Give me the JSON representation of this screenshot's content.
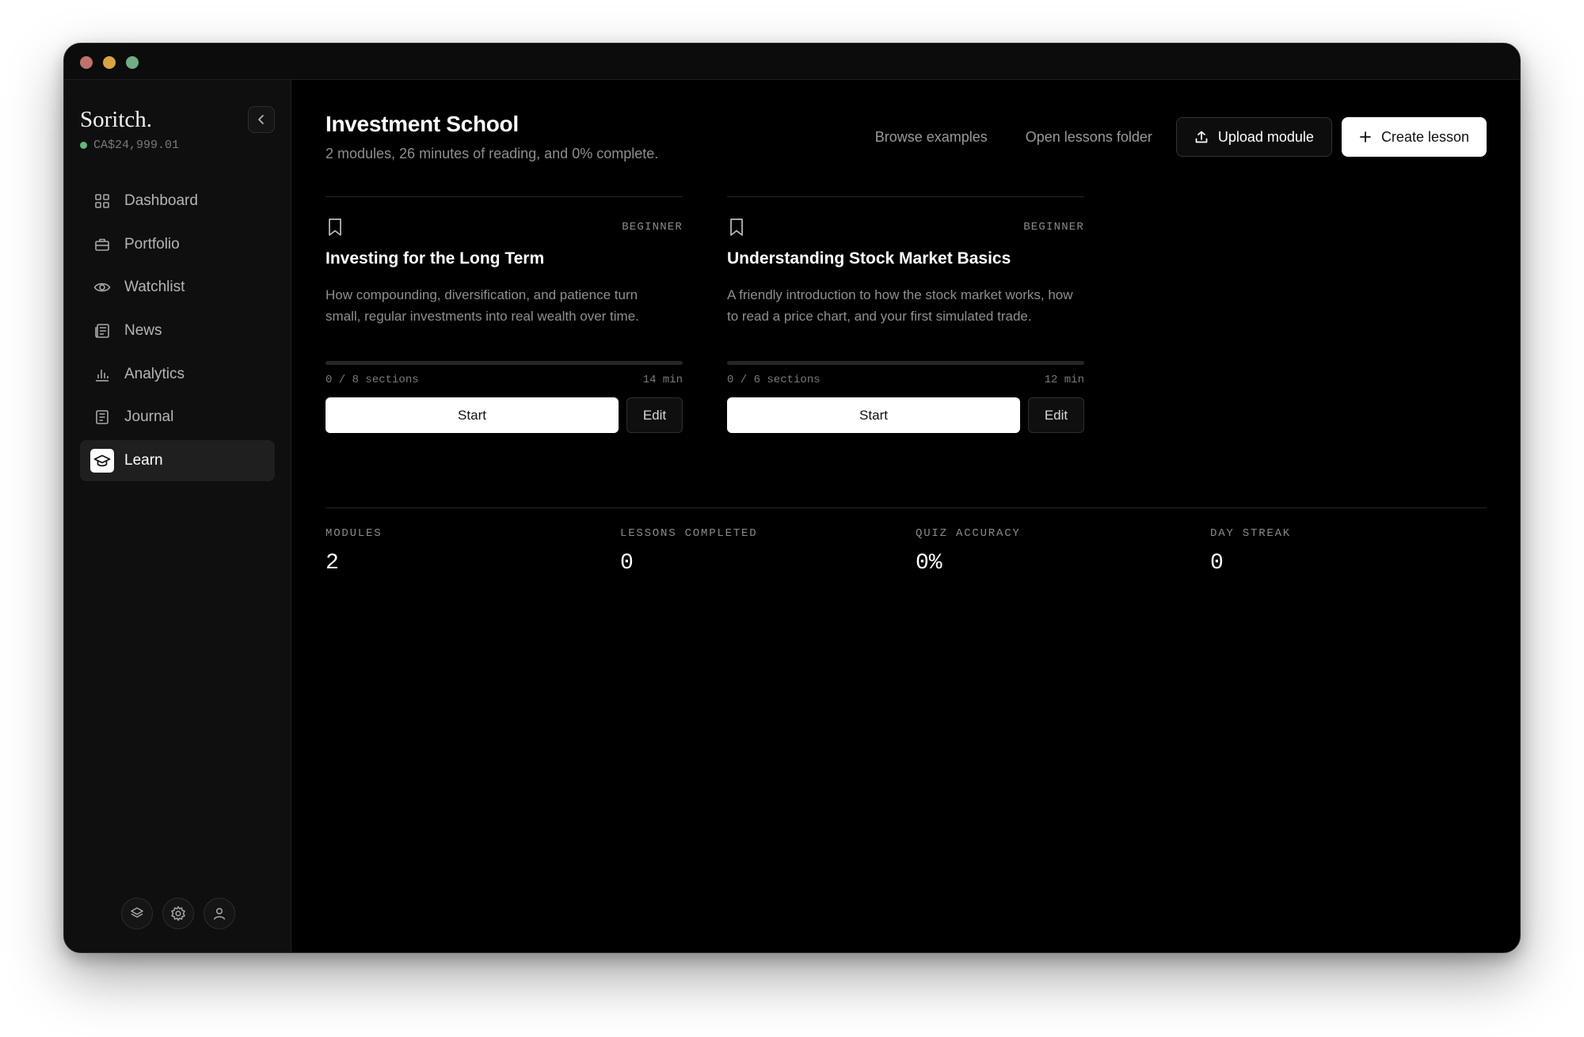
{
  "window": {
    "controls": [
      "close",
      "minimize",
      "zoom"
    ]
  },
  "sidebar": {
    "brand": "Soritch.",
    "balance": "CA$24,999.01",
    "balance_status_color": "#5dbb7a",
    "collapse_icon": "chevron-left-icon",
    "items": [
      {
        "label": "Dashboard",
        "icon": "grid-icon",
        "active": false
      },
      {
        "label": "Portfolio",
        "icon": "briefcase-icon",
        "active": false
      },
      {
        "label": "Watchlist",
        "icon": "eye-icon",
        "active": false
      },
      {
        "label": "News",
        "icon": "newspaper-icon",
        "active": false
      },
      {
        "label": "Analytics",
        "icon": "bar-chart-icon",
        "active": false
      },
      {
        "label": "Journal",
        "icon": "notebook-icon",
        "active": false
      },
      {
        "label": "Learn",
        "icon": "graduation-cap-icon",
        "active": true
      }
    ],
    "footer_icons": [
      "layers-icon",
      "gear-icon",
      "user-icon"
    ]
  },
  "header": {
    "title": "Investment School",
    "subtitle": "2 modules, 26 minutes of reading, and 0% complete.",
    "browse_examples": "Browse examples",
    "open_lessons_folder": "Open lessons folder",
    "upload_module": "Upload module",
    "create_lesson": "Create lesson"
  },
  "modules": [
    {
      "level": "BEGINNER",
      "title": "Investing for the Long Term",
      "description": "How compounding, diversification, and patience turn small, regular investments into real wealth over time.",
      "progress_fraction": 0,
      "sections": "0 / 8 sections",
      "duration": "14 min",
      "start_label": "Start",
      "edit_label": "Edit"
    },
    {
      "level": "BEGINNER",
      "title": "Understanding Stock Market Basics",
      "description": "A friendly introduction to how the stock market works, how to read a price chart, and your first simulated trade.",
      "progress_fraction": 0,
      "sections": "0 / 6 sections",
      "duration": "12 min",
      "start_label": "Start",
      "edit_label": "Edit"
    }
  ],
  "stats": [
    {
      "label": "MODULES",
      "value": "2"
    },
    {
      "label": "LESSONS COMPLETED",
      "value": "0"
    },
    {
      "label": "QUIZ ACCURACY",
      "value": "0%"
    },
    {
      "label": "DAY STREAK",
      "value": "0"
    }
  ],
  "colors": {
    "background": "#000000",
    "sidebar": "#0f0f0f",
    "accent": "#ffffff"
  }
}
